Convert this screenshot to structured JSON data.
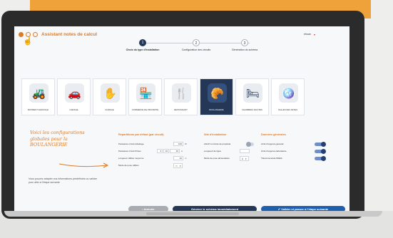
{
  "colors": {
    "accent": "#e07a22",
    "navy": "#243757",
    "blue": "#1f5fb0"
  },
  "header": {
    "title": "Assistant notes de calcul",
    "user": "ehuan",
    "pointer_icon": "hand-pointer-icon"
  },
  "steps": [
    {
      "number": "1",
      "label": "Choix du type d'installation",
      "active": true
    },
    {
      "number": "2",
      "label": "Configuration des circuits",
      "active": false
    },
    {
      "number": "3",
      "label": "Génération du schéma",
      "active": false
    }
  ],
  "installation_types": [
    {
      "label": "BATIMENT AGRICOLE",
      "icon": "tractor-icon",
      "glyph": "🚜",
      "selected": false
    },
    {
      "label": "GARAGE",
      "icon": "car-wrench-icon",
      "glyph": "🚗",
      "selected": false
    },
    {
      "label": "GUMAGE",
      "icon": "hand-coin-icon",
      "glyph": "✋",
      "selected": false
    },
    {
      "label": "COMMERCE DE PROXIMITE",
      "icon": "storefront-icon",
      "glyph": "🏪",
      "selected": false
    },
    {
      "label": "RESTAURANT",
      "icon": "chef-icon",
      "glyph": "🍴",
      "selected": false
    },
    {
      "label": "BOULANGERIE",
      "icon": "bread-icon",
      "glyph": "🥐",
      "selected": true
    },
    {
      "label": "CHAMBRES D'HOTES",
      "icon": "bed-icon",
      "glyph": "🛏",
      "selected": false
    },
    {
      "label": "SALLES DES FETES",
      "icon": "disco-ball-icon",
      "glyph": "🪩",
      "selected": false
    }
  ],
  "notes": {
    "handwritten": "Voici les configurations globales pour la BOULANGERIE",
    "hint": "Vous pouvez adapter vos informations prédéfinies ou valider pour aller à l'étape suivante"
  },
  "repartitions": {
    "title": "Répartitions par défaut (par circuit)",
    "rows": [
      {
        "label": "Puissance circuit éclairage",
        "values": [
          "100"
        ],
        "unit": "W"
      },
      {
        "label": "Puissance circuit Prises",
        "values": [
          "3",
          "10",
          "16"
        ],
        "unit": "A"
      },
      {
        "label": "Longueur câbles moyenne",
        "values": [
          "20"
        ],
        "unit": "m"
      }
    ],
    "pose_label": "Mode de pose câbles",
    "pose_value": "▭"
  },
  "site": {
    "title": "Site d'installation",
    "rows": [
      {
        "label": "AGCP en limite de propriété",
        "kind": "toggle"
      },
      {
        "label": "Longueur de ligne",
        "kind": "field"
      },
      {
        "label": "Mode de pose alimentation",
        "kind": "select",
        "value": "Å"
      }
    ]
  },
  "general": {
    "title": "Données générales",
    "rows": [
      {
        "label": "Arrêt d'urgence général",
        "on": true
      },
      {
        "label": "Arrêt d'urgence laboratoire",
        "on": true
      },
      {
        "label": "Télécommande BAES",
        "on": true
      }
    ]
  },
  "buttons": {
    "previous": "‹ Annuler",
    "generate": "Générer le schéma immédiatement",
    "validate": "✔ Valider et passer à l'étape suivante"
  }
}
